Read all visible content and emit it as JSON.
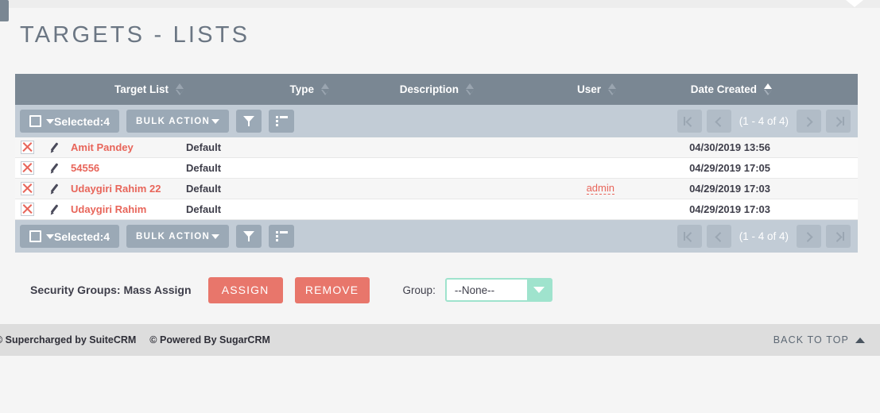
{
  "page": {
    "title": "TARGETS - LISTS"
  },
  "top_bar": {
    "sidebar_handle_icon": "sidebar-toggle-handle",
    "collapse_icon": "caret-down-icon"
  },
  "table": {
    "columns": [
      {
        "label": "Target List",
        "sort": "none"
      },
      {
        "label": "Type",
        "sort": "none"
      },
      {
        "label": "Description",
        "sort": "none"
      },
      {
        "label": "User",
        "sort": "none"
      },
      {
        "label": "Date Created",
        "sort": "asc"
      }
    ],
    "rows": [
      {
        "delete_icon": "delete-x-icon",
        "edit_icon": "pencil-edit-icon",
        "name": "Amit Pandey",
        "type": "Default",
        "description": "",
        "user": "",
        "date_created": "04/30/2019 13:56"
      },
      {
        "delete_icon": "delete-x-icon",
        "edit_icon": "pencil-edit-icon",
        "name": "54556",
        "type": "Default",
        "description": "",
        "user": "",
        "date_created": "04/29/2019 17:05"
      },
      {
        "delete_icon": "delete-x-icon",
        "edit_icon": "pencil-edit-icon",
        "name": "Udaygiri Rahim 22",
        "type": "Default",
        "description": "",
        "user": "admin",
        "date_created": "04/29/2019 17:03"
      },
      {
        "delete_icon": "delete-x-icon",
        "edit_icon": "pencil-edit-icon",
        "name": "Udaygiri Rahim",
        "type": "Default",
        "description": "",
        "user": "",
        "date_created": "04/29/2019 17:03"
      }
    ]
  },
  "toolbar": {
    "selected_label": "Selected:4",
    "bulk_action_label": "BULK ACTION",
    "filter_icon": "funnel-filter-icon",
    "columns_icon": "column-chooser-icon",
    "checkbox_icon": "checkbox-icon",
    "caret_icon": "caret-down-icon"
  },
  "pagination": {
    "range_label": "(1 - 4 of 4)",
    "first_icon": "first-page-icon",
    "prev_icon": "previous-page-icon",
    "next_icon": "next-page-icon",
    "last_icon": "last-page-icon"
  },
  "mass_assign": {
    "label": "Security Groups: Mass Assign",
    "assign_label": "ASSIGN",
    "remove_label": "REMOVE",
    "group_label": "Group:",
    "group_value": "--None--",
    "group_options": [
      "--None--"
    ],
    "dropdown_icon": "caret-down-icon"
  },
  "footer": {
    "suitecrm_text": "© Supercharged by SuiteCRM",
    "sugarcrm_text": "© Powered By SugarCRM",
    "back_to_top_label": "BACK TO TOP",
    "back_to_top_icon": "caret-up-icon"
  },
  "colors": {
    "header_bg": "#7a8793",
    "toolbar_bg": "#c2ccd6",
    "accent_salmon": "#e8655a",
    "accent_teal": "#9fe3cd",
    "page_bg": "#f5f5f5",
    "footer_bg": "#dddddd"
  }
}
